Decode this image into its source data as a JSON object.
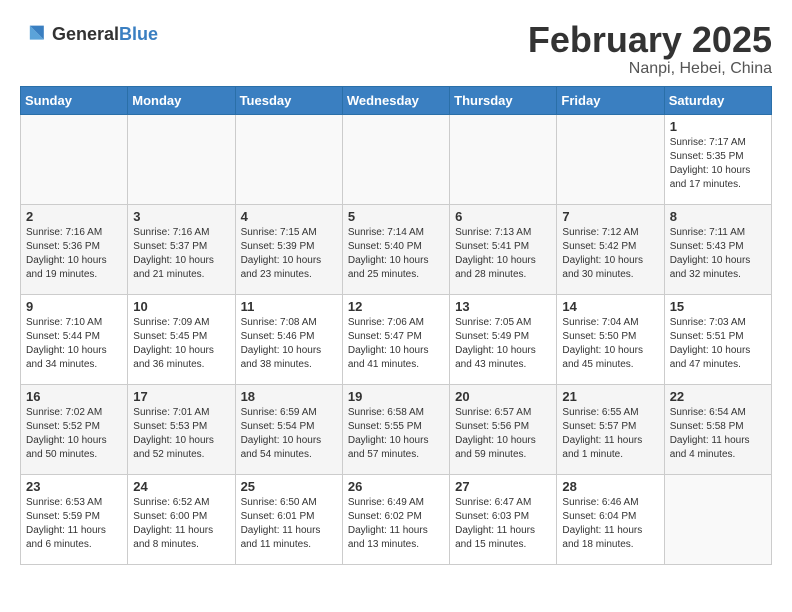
{
  "header": {
    "logo_general": "General",
    "logo_blue": "Blue",
    "title": "February 2025",
    "subtitle": "Nanpi, Hebei, China"
  },
  "days_of_week": [
    "Sunday",
    "Monday",
    "Tuesday",
    "Wednesday",
    "Thursday",
    "Friday",
    "Saturday"
  ],
  "weeks": [
    [
      {
        "day": "",
        "info": ""
      },
      {
        "day": "",
        "info": ""
      },
      {
        "day": "",
        "info": ""
      },
      {
        "day": "",
        "info": ""
      },
      {
        "day": "",
        "info": ""
      },
      {
        "day": "",
        "info": ""
      },
      {
        "day": "1",
        "info": "Sunrise: 7:17 AM\nSunset: 5:35 PM\nDaylight: 10 hours\nand 17 minutes."
      }
    ],
    [
      {
        "day": "2",
        "info": "Sunrise: 7:16 AM\nSunset: 5:36 PM\nDaylight: 10 hours\nand 19 minutes."
      },
      {
        "day": "3",
        "info": "Sunrise: 7:16 AM\nSunset: 5:37 PM\nDaylight: 10 hours\nand 21 minutes."
      },
      {
        "day": "4",
        "info": "Sunrise: 7:15 AM\nSunset: 5:39 PM\nDaylight: 10 hours\nand 23 minutes."
      },
      {
        "day": "5",
        "info": "Sunrise: 7:14 AM\nSunset: 5:40 PM\nDaylight: 10 hours\nand 25 minutes."
      },
      {
        "day": "6",
        "info": "Sunrise: 7:13 AM\nSunset: 5:41 PM\nDaylight: 10 hours\nand 28 minutes."
      },
      {
        "day": "7",
        "info": "Sunrise: 7:12 AM\nSunset: 5:42 PM\nDaylight: 10 hours\nand 30 minutes."
      },
      {
        "day": "8",
        "info": "Sunrise: 7:11 AM\nSunset: 5:43 PM\nDaylight: 10 hours\nand 32 minutes."
      }
    ],
    [
      {
        "day": "9",
        "info": "Sunrise: 7:10 AM\nSunset: 5:44 PM\nDaylight: 10 hours\nand 34 minutes."
      },
      {
        "day": "10",
        "info": "Sunrise: 7:09 AM\nSunset: 5:45 PM\nDaylight: 10 hours\nand 36 minutes."
      },
      {
        "day": "11",
        "info": "Sunrise: 7:08 AM\nSunset: 5:46 PM\nDaylight: 10 hours\nand 38 minutes."
      },
      {
        "day": "12",
        "info": "Sunrise: 7:06 AM\nSunset: 5:47 PM\nDaylight: 10 hours\nand 41 minutes."
      },
      {
        "day": "13",
        "info": "Sunrise: 7:05 AM\nSunset: 5:49 PM\nDaylight: 10 hours\nand 43 minutes."
      },
      {
        "day": "14",
        "info": "Sunrise: 7:04 AM\nSunset: 5:50 PM\nDaylight: 10 hours\nand 45 minutes."
      },
      {
        "day": "15",
        "info": "Sunrise: 7:03 AM\nSunset: 5:51 PM\nDaylight: 10 hours\nand 47 minutes."
      }
    ],
    [
      {
        "day": "16",
        "info": "Sunrise: 7:02 AM\nSunset: 5:52 PM\nDaylight: 10 hours\nand 50 minutes."
      },
      {
        "day": "17",
        "info": "Sunrise: 7:01 AM\nSunset: 5:53 PM\nDaylight: 10 hours\nand 52 minutes."
      },
      {
        "day": "18",
        "info": "Sunrise: 6:59 AM\nSunset: 5:54 PM\nDaylight: 10 hours\nand 54 minutes."
      },
      {
        "day": "19",
        "info": "Sunrise: 6:58 AM\nSunset: 5:55 PM\nDaylight: 10 hours\nand 57 minutes."
      },
      {
        "day": "20",
        "info": "Sunrise: 6:57 AM\nSunset: 5:56 PM\nDaylight: 10 hours\nand 59 minutes."
      },
      {
        "day": "21",
        "info": "Sunrise: 6:55 AM\nSunset: 5:57 PM\nDaylight: 11 hours\nand 1 minute."
      },
      {
        "day": "22",
        "info": "Sunrise: 6:54 AM\nSunset: 5:58 PM\nDaylight: 11 hours\nand 4 minutes."
      }
    ],
    [
      {
        "day": "23",
        "info": "Sunrise: 6:53 AM\nSunset: 5:59 PM\nDaylight: 11 hours\nand 6 minutes."
      },
      {
        "day": "24",
        "info": "Sunrise: 6:52 AM\nSunset: 6:00 PM\nDaylight: 11 hours\nand 8 minutes."
      },
      {
        "day": "25",
        "info": "Sunrise: 6:50 AM\nSunset: 6:01 PM\nDaylight: 11 hours\nand 11 minutes."
      },
      {
        "day": "26",
        "info": "Sunrise: 6:49 AM\nSunset: 6:02 PM\nDaylight: 11 hours\nand 13 minutes."
      },
      {
        "day": "27",
        "info": "Sunrise: 6:47 AM\nSunset: 6:03 PM\nDaylight: 11 hours\nand 15 minutes."
      },
      {
        "day": "28",
        "info": "Sunrise: 6:46 AM\nSunset: 6:04 PM\nDaylight: 11 hours\nand 18 minutes."
      },
      {
        "day": "",
        "info": ""
      }
    ]
  ]
}
